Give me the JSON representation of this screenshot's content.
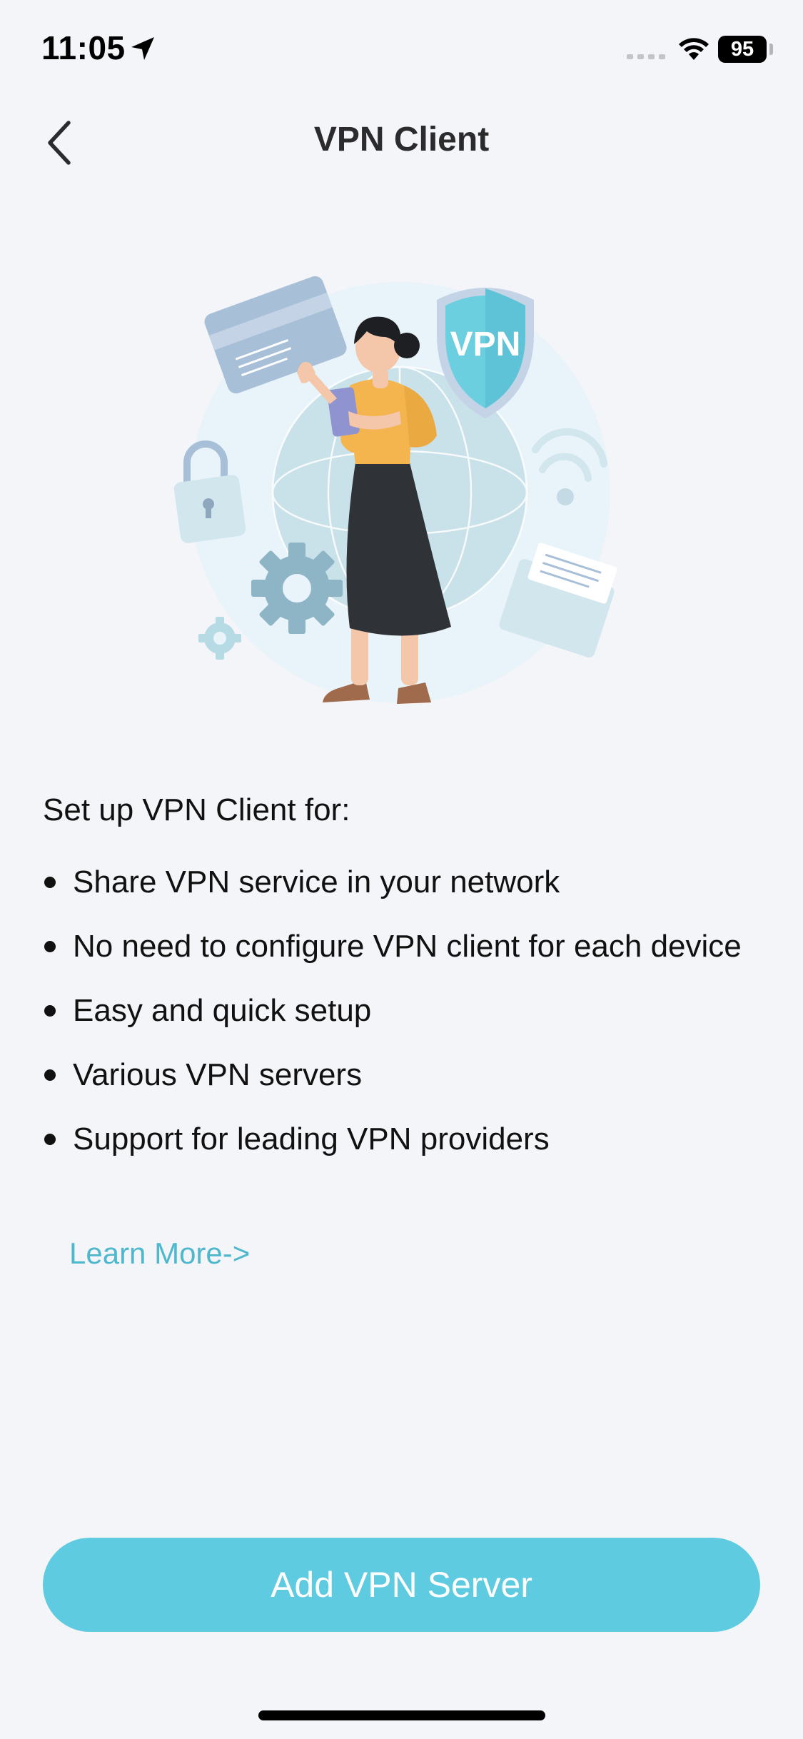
{
  "status_bar": {
    "time": "11:05",
    "battery": "95",
    "icons": [
      "location-arrow-icon",
      "signal-icon",
      "wifi-icon",
      "battery-icon"
    ]
  },
  "nav": {
    "title": "VPN Client",
    "back_icon": "chevron-left-icon"
  },
  "hero": {
    "shield_label": "VPN"
  },
  "content": {
    "intro": "Set up VPN Client for:",
    "features": [
      "Share VPN service in your network",
      "No need to configure VPN client for each device",
      "Easy and quick setup",
      "Various VPN servers",
      "Support for leading VPN providers"
    ],
    "learn_more": "Learn More->"
  },
  "actions": {
    "primary": "Add VPN Server"
  },
  "colors": {
    "background": "#f4f5f9",
    "accent": "#5ecbe0",
    "link": "#4fb8cc",
    "title": "#2b2b2e"
  }
}
